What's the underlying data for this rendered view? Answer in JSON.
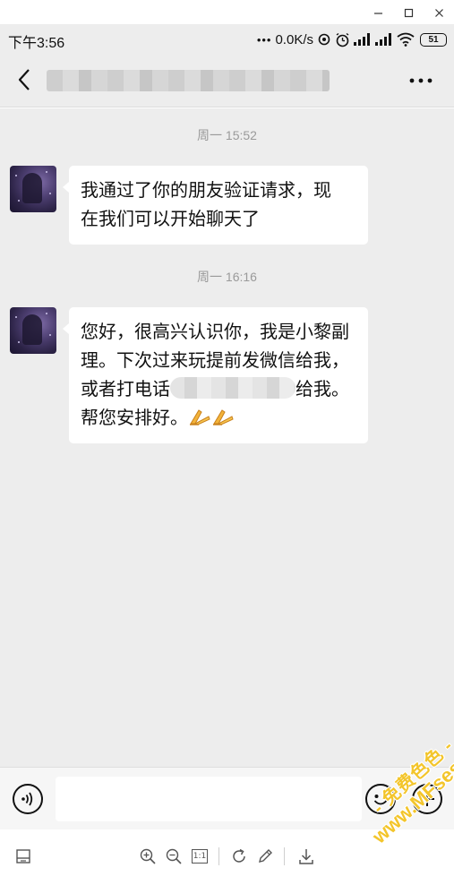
{
  "window": {
    "controls": [
      "minimize-icon",
      "maximize-icon",
      "close-icon"
    ]
  },
  "status_bar": {
    "time": "下午3:56",
    "dots": "•••",
    "network_speed": "0.0K/s",
    "battery_level": "51",
    "icons": [
      "sync-icon",
      "alarm-icon",
      "signal-icon",
      "signal-icon",
      "wifi-icon",
      "battery-icon"
    ]
  },
  "header": {
    "back_icon": "chevron-left-icon",
    "title": "",
    "more_icon": "more-horizontal-icon"
  },
  "chat": {
    "messages": [
      {
        "timestamp": "周一 15:52",
        "line1": "我通过了你的朋友验证请求，现",
        "line2": "在我们可以开始聊天了"
      },
      {
        "timestamp": "周一 16:16",
        "line1": "您好，很高兴认识你，我是小黎副",
        "line2": "理。下次过来玩提前发微信给我，",
        "line3_before": "或者打电话",
        "line3_redacted": "",
        "line3_after": "给我。",
        "line4": "帮您安排好。",
        "emoji": [
          "folded-hands-emoji",
          "folded-hands-emoji"
        ]
      }
    ]
  },
  "input_bar": {
    "voice_icon": "voice-icon",
    "input_value": "",
    "emoji_icon": "smiley-icon",
    "plus_icon": "plus-circle-icon"
  },
  "viewer_toolbar": {
    "items": [
      "panel-icon",
      "zoom-in-icon",
      "zoom-out-icon",
      "actual-size-icon",
      "rotate-icon",
      "edit-icon",
      "download-icon"
    ],
    "actual_size_label": "1:1"
  },
  "watermark": {
    "line1": "- 免费色色 -",
    "line2": "www.MFsese.com"
  },
  "colors": {
    "chat_background": "#ededed",
    "bubble": "#ffffff",
    "timestamp": "#9a9a9a",
    "watermark": "#f3c52b"
  }
}
